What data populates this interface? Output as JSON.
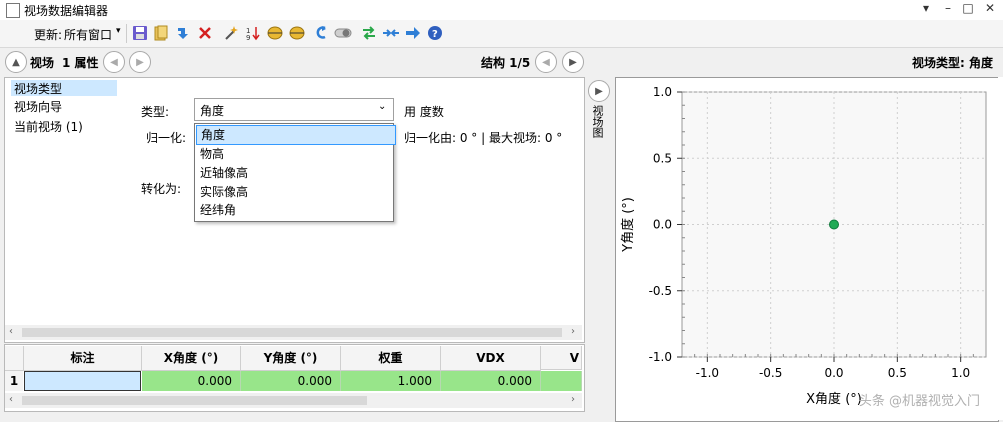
{
  "window": {
    "title": "视场数据编辑器",
    "minimize": "–",
    "maximize": "□",
    "close": "✕",
    "pin": "▾"
  },
  "toolbar": {
    "update_label": "更新:",
    "update_value": "所有窗口",
    "icons": [
      "save-icon",
      "open-icon",
      "arrow-down-icon",
      "delete-icon",
      "wand-icon",
      "sort-icon",
      "ellipse-icon",
      "ellipse-icon",
      "undo-icon",
      "toggle-icon",
      "swap-icon",
      "collapse-icon",
      "arrow-right-icon",
      "help-icon"
    ]
  },
  "header": {
    "section_title": "视场",
    "attr_count": "1 属性",
    "structure": "结构 1/5",
    "field_type_label": "视场类型: 角度"
  },
  "tree": {
    "items": [
      "视场类型",
      "视场向导",
      "当前视场 (1)"
    ]
  },
  "form": {
    "type_label": "类型:",
    "type_value": "角度",
    "normalize_label": "归一化:",
    "convert_label": "转化为:",
    "use_degrees": "用 度数",
    "normalize_info": "归一化由: 0 ° | 最大视场: 0 °",
    "options": [
      "角度",
      "物高",
      "近轴像高",
      "实际像高",
      "经纬角"
    ]
  },
  "table": {
    "headers": [
      "标注",
      "X角度 (°)",
      "Y角度 (°)",
      "权重",
      "VDX",
      "V"
    ],
    "rows": [
      {
        "num": "1",
        "label": "",
        "x": "0.000",
        "y": "0.000",
        "weight": "1.000",
        "vdx": "0.000"
      }
    ]
  },
  "side_tab": {
    "label": "视场图"
  },
  "chart_data": {
    "type": "scatter",
    "x": [
      0.0
    ],
    "y": [
      0.0
    ],
    "xlim": [
      -1.2,
      1.2
    ],
    "ylim": [
      -1.0,
      1.0
    ],
    "xticks": [
      "-1.0",
      "-0.5",
      "0.0",
      "0.5",
      "1.0"
    ],
    "yticks": [
      "1.0",
      "0.5",
      "0.0",
      "-0.5",
      "-1.0"
    ],
    "xlabel": "X角度 (°)",
    "ylabel": "Y角度 (°)",
    "grid": true,
    "point_color": "#1faa55"
  },
  "watermark": "头条 @机器视觉入门",
  "colors": {
    "selection": "#cde8ff",
    "cell_green": "#98e58a"
  }
}
